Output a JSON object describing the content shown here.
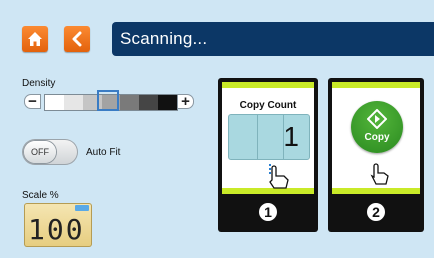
{
  "header": {
    "home_icon": "home-icon",
    "back_icon": "back-chevron-icon",
    "title": "Scanning...",
    "accent": "#f07a1f",
    "title_bg": "#0c3766"
  },
  "density": {
    "label": "Density",
    "minus": "−",
    "plus": "+",
    "levels": 7,
    "selected_level": 4
  },
  "auto_fit": {
    "toggle_state": "OFF",
    "label": "Auto Fit"
  },
  "scale": {
    "label": "Scale %",
    "value": "100"
  },
  "steps": {
    "copy_count": {
      "title": "Copy Count",
      "value": "1",
      "step_number": "1"
    },
    "copy": {
      "label": "Copy",
      "step_number": "2"
    },
    "highlight": "#c9ea28"
  }
}
